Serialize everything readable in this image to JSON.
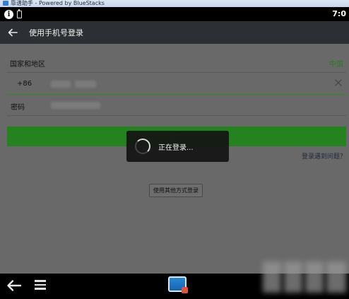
{
  "window": {
    "title": "靠谱助手 - Powered by BlueStacks"
  },
  "status_bar": {
    "time": "7:0",
    "icons": [
      "info-icon",
      "battery-icon"
    ]
  },
  "toolbar": {
    "back_icon": "arrow-left-icon",
    "title": "使用手机号登录"
  },
  "form": {
    "region_label": "国家和地区",
    "region_value": "中国",
    "country_code": "+86",
    "phone_value": "",
    "phone_placeholder": "",
    "clear_icon": "close-icon",
    "password_label": "密码",
    "password_value": "",
    "login_button": "登录",
    "login_problem_link": "登录遇到问题？",
    "other_login_button": "使用其他方式登录"
  },
  "loading_dialog": {
    "text": "正在登录...",
    "icon": "spinner-icon"
  },
  "nav_bar": {
    "icons": [
      "back-arrow-icon",
      "menu-icon",
      "bluestacks-icon"
    ]
  },
  "colors": {
    "toolbar_bg": "#2c2f33",
    "overlay_bg": "#696969",
    "accent_green": "#24821f",
    "region_green": "#2a7a22"
  }
}
